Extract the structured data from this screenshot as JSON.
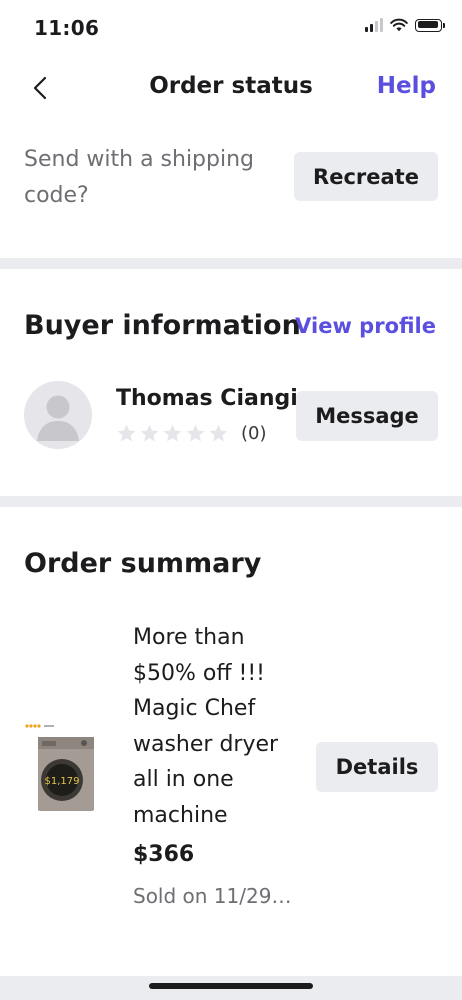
{
  "status_bar": {
    "time": "11:06"
  },
  "nav": {
    "title": "Order status",
    "help_label": "Help"
  },
  "shipping": {
    "prompt": "Send with a shipping code?",
    "recreate_label": "Recreate"
  },
  "buyer": {
    "heading": "Buyer information",
    "view_profile_label": "View profile",
    "name": "Thomas Ciangi",
    "rating": 0,
    "rating_max": 5,
    "review_count": "(0)",
    "message_label": "Message"
  },
  "order_summary": {
    "heading": "Order summary",
    "item": {
      "title": "More than\n$50% off !!!\nMagic Chef\nwasher dryer\nall in one\nmachine",
      "price": "$366",
      "sold_date": "Sold on 11/29…",
      "details_label": "Details",
      "thumbnail_price_text": "$1,179"
    }
  },
  "colors": {
    "accent": "#5b4fe0",
    "button_bg": "#ebecef",
    "divider": "#ebecef",
    "text_primary": "#1c1c1e",
    "text_secondary": "#6e6e73",
    "star_empty": "#e5e5ea"
  },
  "icons": [
    "back-chevron-icon",
    "signal-icon",
    "wifi-icon",
    "battery-icon",
    "person-icon",
    "star-icon"
  ]
}
